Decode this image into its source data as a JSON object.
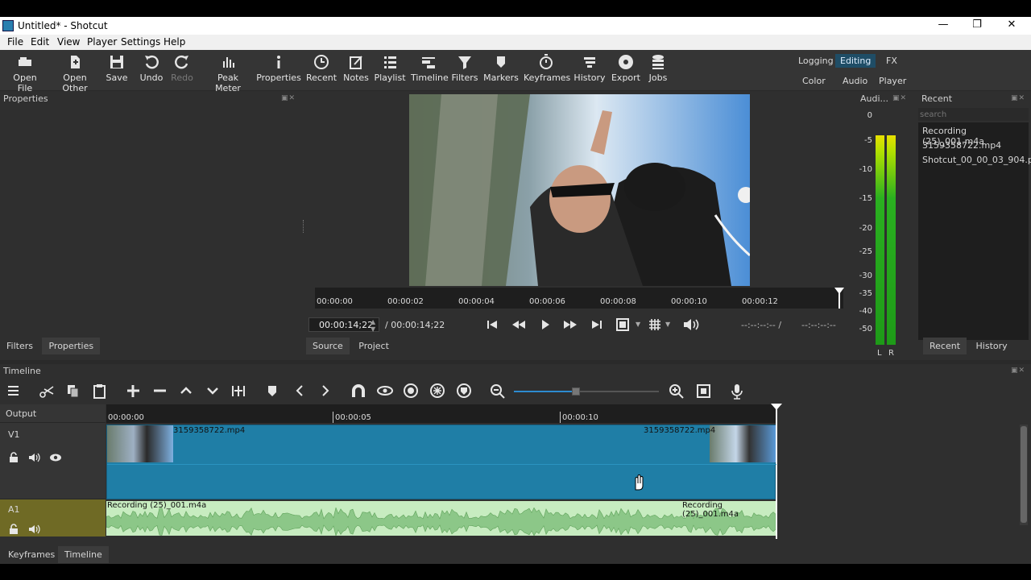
{
  "window": {
    "title": "Untitled* - Shotcut",
    "controls": {
      "minimize": "—",
      "maximize": "❐",
      "close": "✕"
    }
  },
  "menu": [
    "File",
    "Edit",
    "View",
    "Player",
    "Settings",
    "Help"
  ],
  "toolbar": {
    "tools": [
      {
        "label": "Open File",
        "icon": "open-file-icon"
      },
      {
        "label": "Open Other",
        "icon": "open-other-icon"
      },
      {
        "label": "Save",
        "icon": "save-icon"
      },
      {
        "label": "Undo",
        "icon": "undo-icon"
      },
      {
        "label": "Redo",
        "icon": "redo-icon",
        "disabled": true
      },
      {
        "label": "Peak Meter",
        "icon": "peak-meter-icon"
      },
      {
        "label": "Properties",
        "icon": "properties-icon"
      },
      {
        "label": "Recent",
        "icon": "recent-icon"
      },
      {
        "label": "Notes",
        "icon": "notes-icon"
      },
      {
        "label": "Playlist",
        "icon": "playlist-icon"
      },
      {
        "label": "Timeline",
        "icon": "timeline-icon"
      },
      {
        "label": "Filters",
        "icon": "filters-icon"
      },
      {
        "label": "Markers",
        "icon": "markers-icon"
      },
      {
        "label": "Keyframes",
        "icon": "keyframes-icon"
      },
      {
        "label": "History",
        "icon": "history-icon"
      },
      {
        "label": "Export",
        "icon": "export-icon"
      },
      {
        "label": "Jobs",
        "icon": "jobs-icon"
      }
    ],
    "layouts_top": [
      "Logging",
      "Editing",
      "FX"
    ],
    "layouts_bottom": [
      "Color",
      "Audio",
      "Player"
    ],
    "active_layout": "Editing",
    "active_color": "#1f4d66"
  },
  "properties_panel": {
    "title": "Properties",
    "tabs": [
      "Filters",
      "Properties"
    ]
  },
  "player": {
    "ruler_labels": [
      "00:00:00",
      "00:00:02",
      "00:00:04",
      "00:00:06",
      "00:00:08",
      "00:00:10",
      "00:00:12"
    ],
    "position": "00:00:14;22",
    "duration": "/ 00:00:14;22",
    "in_point": "--:--:--:-- /",
    "out_point": "--:--:--:--",
    "tabs": [
      "Source",
      "Project"
    ]
  },
  "audio_meter": {
    "title": "Audi...",
    "scale": [
      "0",
      "-5",
      "-10",
      "-15",
      "-20",
      "-25",
      "-30",
      "-35",
      "-40",
      "-50"
    ],
    "channels": [
      "L",
      "R"
    ]
  },
  "recent_panel": {
    "title": "Recent",
    "search_placeholder": "search",
    "items": [
      "Recording (25)_001.m4a",
      "3159358722.mp4",
      "Shotcut_00_00_03_904.p..."
    ],
    "tabs": [
      "Recent",
      "History"
    ]
  },
  "timeline": {
    "title": "Timeline",
    "ruler_labels": [
      "00:00:00",
      "00:00:05",
      "00:00:10"
    ],
    "tracks": [
      {
        "name": "Output"
      },
      {
        "name": "V1",
        "clip_start": "3159358722.mp4",
        "clip_end": "3159358722.mp4"
      },
      {
        "name": "A1",
        "clip_start": "Recording (25)_001.m4a",
        "clip_end": "Recording (25)_001.m4a"
      }
    ],
    "video_clip_color": "#1f7ea6",
    "audio_clip_color": "#c7ecc0",
    "audio_track_head_color": "#6f6a25"
  },
  "bottom_tabs": [
    "Keyframes",
    "Timeline"
  ]
}
